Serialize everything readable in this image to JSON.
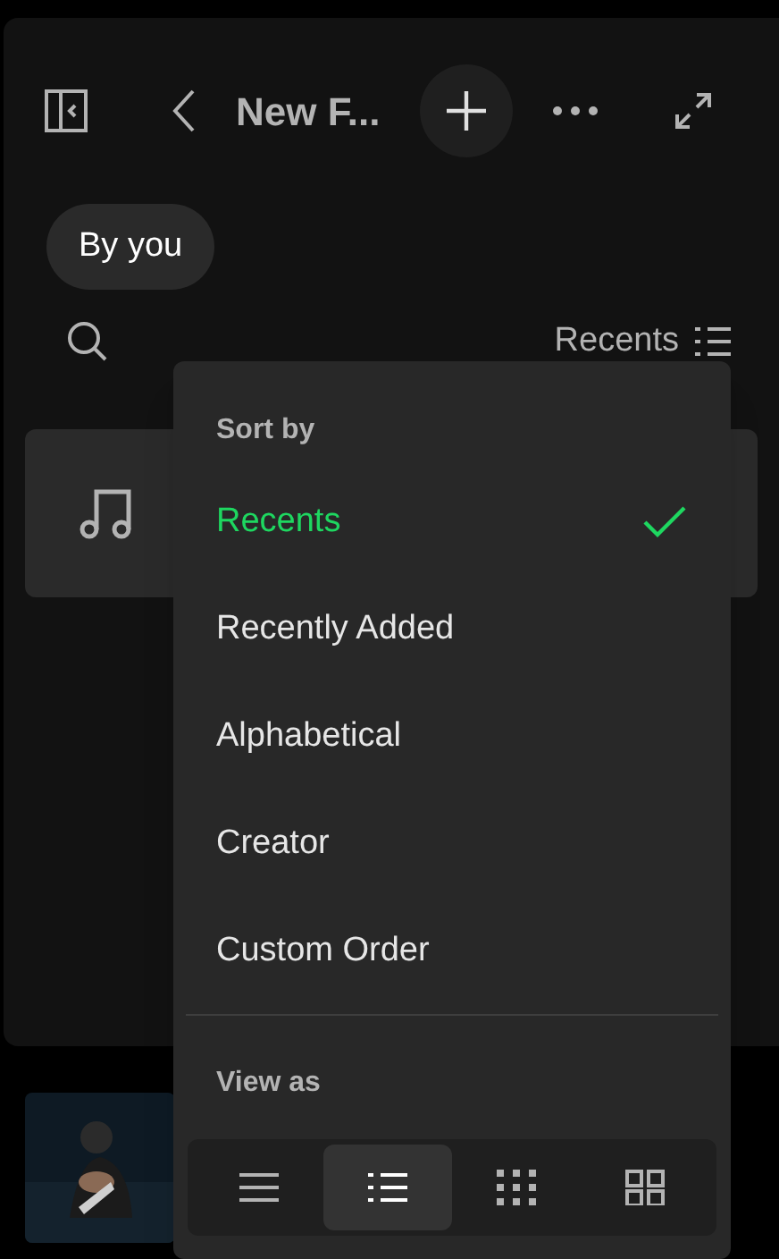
{
  "header": {
    "title": "New F..."
  },
  "filters": [
    {
      "label": "By you",
      "selected": true
    }
  ],
  "sort_button": {
    "label": "Recents"
  },
  "menu": {
    "sort_heading": "Sort by",
    "sort_options": [
      {
        "label": "Recents",
        "selected": true
      },
      {
        "label": "Recently Added",
        "selected": false
      },
      {
        "label": "Alphabetical",
        "selected": false
      },
      {
        "label": "Creator",
        "selected": false
      },
      {
        "label": "Custom Order",
        "selected": false
      }
    ],
    "view_heading": "View as",
    "view_options": [
      {
        "kind": "compact",
        "selected": false
      },
      {
        "kind": "list",
        "selected": true
      },
      {
        "kind": "compact-grid",
        "selected": false
      },
      {
        "kind": "grid",
        "selected": false
      }
    ]
  }
}
